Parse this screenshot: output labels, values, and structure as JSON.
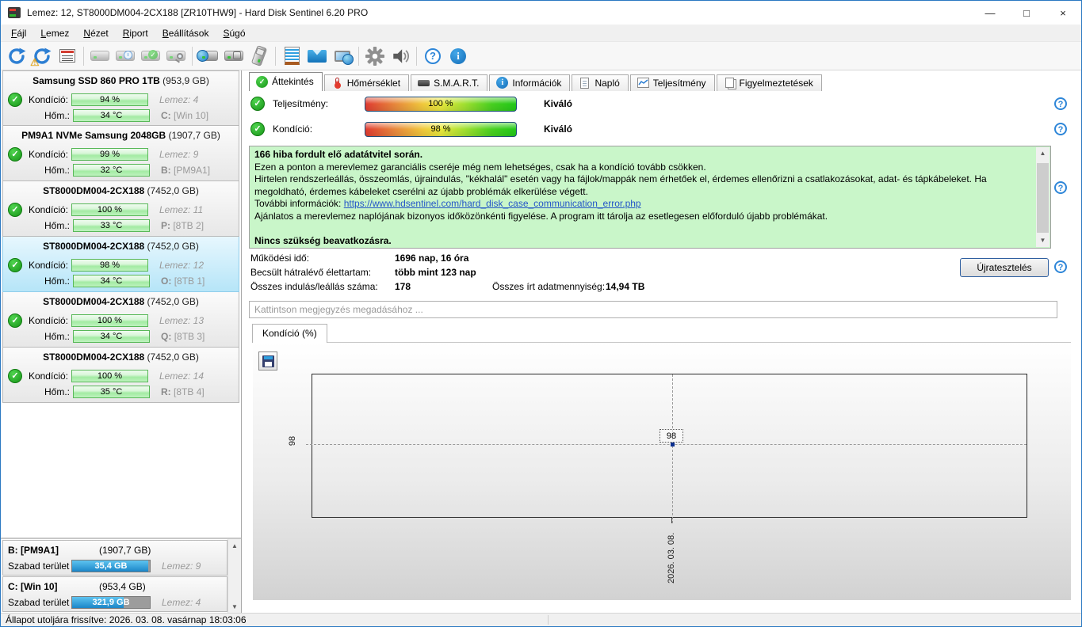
{
  "window": {
    "title": "Lemez: 12, ST8000DM004-2CX188 [ZR10THW9]  -  Hard Disk Sentinel 6.20 PRO",
    "minimize": "—",
    "maximize": "□",
    "close": "×"
  },
  "menu": {
    "items": [
      "Fájl",
      "Lemez",
      "Nézet",
      "Riport",
      "Beállítások",
      "Súgó"
    ]
  },
  "toolbar": {
    "icons": [
      "refresh-icon",
      "refresh-warning-icon",
      "report-window-icon",
      "disk-offline-icon",
      "disk-schedule-icon",
      "disk-accept-icon",
      "disk-search-icon",
      "disk-web-icon",
      "disk-tools-icon",
      "disk-eject-icon",
      "notes-icon",
      "mail-icon",
      "network-icon",
      "settings-gear-icon",
      "sound-icon",
      "help-icon",
      "info-icon"
    ]
  },
  "labels": {
    "condition": "Kondíció:",
    "temperature": "Hőm.:",
    "free_space": "Szabad terület"
  },
  "sidebar": {
    "disks": [
      {
        "name": "Samsung SSD 860 PRO 1TB",
        "size": "(953,9 GB)",
        "condition": "94 %",
        "disk_label": "Lemez: 4",
        "temp": "34 °C",
        "drive": "C:",
        "volume": "[Win 10]"
      },
      {
        "name": "PM9A1 NVMe Samsung 2048GB",
        "size": "(1907,7 GB)",
        "condition": "99 %",
        "disk_label": "Lemez: 9",
        "temp": "32 °C",
        "drive": "B:",
        "volume": "[PM9A1]"
      },
      {
        "name": "ST8000DM004-2CX188",
        "size": "(7452,0 GB)",
        "condition": "100 %",
        "disk_label": "Lemez: 11",
        "temp": "33 °C",
        "drive": "P:",
        "volume": "[8TB 2]"
      },
      {
        "name": "ST8000DM004-2CX188",
        "size": "(7452,0 GB)",
        "condition": "98 %",
        "disk_label": "Lemez: 12",
        "temp": "34 °C",
        "drive": "O:",
        "volume": "[8TB 1]"
      },
      {
        "name": "ST8000DM004-2CX188",
        "size": "(7452,0 GB)",
        "condition": "100 %",
        "disk_label": "Lemez: 13",
        "temp": "34 °C",
        "drive": "Q:",
        "volume": "[8TB 3]"
      },
      {
        "name": "ST8000DM004-2CX188",
        "size": "(7452,0 GB)",
        "condition": "100 %",
        "disk_label": "Lemez: 14",
        "temp": "35 °C",
        "drive": "R:",
        "volume": "[8TB 4]"
      }
    ],
    "partitions": [
      {
        "drive": "B: [PM9A1]",
        "size": "(1907,7 GB)",
        "free": "35,4 GB",
        "disk_label": "Lemez: 9",
        "used_pct": 98
      },
      {
        "drive": "C: [Win 10]",
        "size": "(953,4 GB)",
        "free": "321,9 GB",
        "disk_label": "Lemez: 4",
        "used_pct": 66
      }
    ]
  },
  "tabs": {
    "items": [
      {
        "label": "Áttekintés"
      },
      {
        "label": "Hőmérséklet"
      },
      {
        "label": "S.M.A.R.T."
      },
      {
        "label": "Információk"
      },
      {
        "label": "Napló"
      },
      {
        "label": "Teljesítmény"
      },
      {
        "label": "Figyelmeztetések"
      }
    ]
  },
  "overview": {
    "performance_label": "Teljesítmény:",
    "performance_value": "100 %",
    "performance_rating": "Kiváló",
    "condition_label": "Kondíció:",
    "condition_value": "98 %",
    "condition_rating": "Kiváló",
    "message": {
      "line1": "166 hiba fordult elő adatátvitel során.",
      "line2": "Ezen a ponton a merevlemez garanciális cseréje még nem lehetséges, csak ha a kondíció tovább csökken.",
      "line3": "Hirtelen rendszerleállás, összeomlás, újraindulás, \"kékhalál\" esetén vagy ha fájlok/mappák nem érhetőek el, érdemes ellenőrizni a csatlakozásokat, adat- és tápkábeleket. Ha megoldható, érdemes kábeleket cserélni az újabb problémák elkerülése végett.",
      "line4_label": "További információk: ",
      "line4_link": "https://www.hdsentinel.com/hard_disk_case_communication_error.php",
      "line5": "Ajánlatos a merevlemez naplójának bizonyos időközönkénti figyelése. A program itt tárolja az esetlegesen előforduló újabb problémákat.",
      "line7": "Nincs szükség beavatkozásra."
    },
    "stats": {
      "power_on_label": "Működési idő:",
      "power_on_value": "1696 nap, 16 óra",
      "lifetime_label": "Becsült hátralévő élettartam:",
      "lifetime_value": "több mint 123 nap",
      "start_stop_label": "Összes indulás/leállás száma:",
      "start_stop_value": "178",
      "written_label": "Összes írt adatmennyiség:",
      "written_value": "14,94 TB"
    },
    "retest_button": "Újratesztelés",
    "comment_placeholder": "Kattintson megjegyzés megadásához ...",
    "history_tab": "Kondíció  (%)"
  },
  "chart_data": {
    "type": "line",
    "title": "Kondíció (%)",
    "x": [
      "2026. 03. 08."
    ],
    "values": [
      98
    ],
    "point_label": "98",
    "ylim": [
      0,
      100
    ],
    "grid": "dashed-crosshair",
    "legend": "none"
  },
  "status_bar": {
    "text": "Állapot utoljára frissítve: 2026. 03. 08. vasárnap 18:03:06"
  }
}
